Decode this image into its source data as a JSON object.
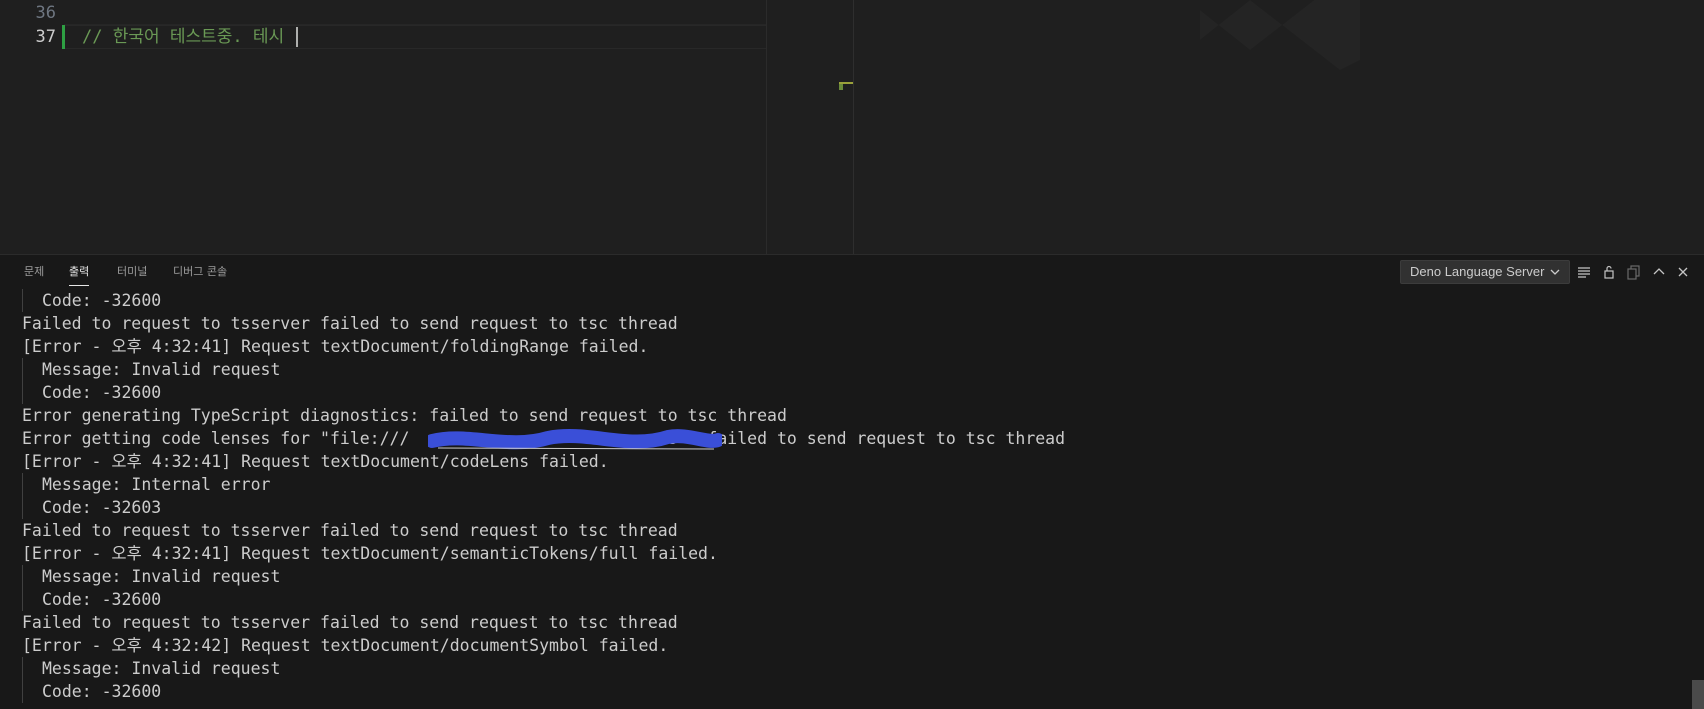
{
  "editor": {
    "line_numbers": [
      "36",
      "37"
    ],
    "active_line": "37",
    "line_37_text": "// 한국어 테스트중. 테시"
  },
  "panel": {
    "tabs": [
      {
        "label": "문제"
      },
      {
        "label": "출력"
      },
      {
        "label": "터미널"
      },
      {
        "label": "디버그 콘솔"
      }
    ],
    "active_tab": "출력",
    "channel": "Deno Language Server",
    "actions": [
      "list-filter-icon",
      "lock-icon",
      "copy-icon",
      "chevron-up-icon",
      "close-icon"
    ],
    "output_lines": [
      {
        "text": "Code: -32600",
        "indent": true
      },
      {
        "text": "Failed to request to tsserver failed to send request to tsc thread",
        "indent": false
      },
      {
        "text": "[Error - 오후 4:32:41] Request textDocument/foldingRange failed.",
        "indent": false
      },
      {
        "text": "Message: Invalid request",
        "indent": true
      },
      {
        "text": "Code: -32600",
        "indent": true
      },
      {
        "text": "Error generating TypeScript diagnostics: failed to send request to tsc thread",
        "indent": false
      },
      {
        "text": "Error getting code lenses for \"file:///                          s\": failed to send request to tsc thread",
        "indent": false
      },
      {
        "text": "[Error - 오후 4:32:41] Request textDocument/codeLens failed.",
        "indent": false
      },
      {
        "text": "Message: Internal error",
        "indent": true
      },
      {
        "text": "Code: -32603",
        "indent": true
      },
      {
        "text": "Failed to request to tsserver failed to send request to tsc thread",
        "indent": false
      },
      {
        "text": "[Error - 오후 4:32:41] Request textDocument/semanticTokens/full failed.",
        "indent": false
      },
      {
        "text": "Message: Invalid request",
        "indent": true
      },
      {
        "text": "Code: -32600",
        "indent": true
      },
      {
        "text": "Failed to request to tsserver failed to send request to tsc thread",
        "indent": false
      },
      {
        "text": "[Error - 오후 4:32:42] Request textDocument/documentSymbol failed.",
        "indent": false
      },
      {
        "text": "Message: Invalid request",
        "indent": true
      },
      {
        "text": "Code: -32600",
        "indent": true
      }
    ]
  },
  "colors": {
    "editor_bg": "#1f1f1f",
    "panel_bg": "#181818",
    "comment_green": "#6a9955",
    "output_text": "#cccccc",
    "redaction_blue": "#3a4fd8"
  }
}
